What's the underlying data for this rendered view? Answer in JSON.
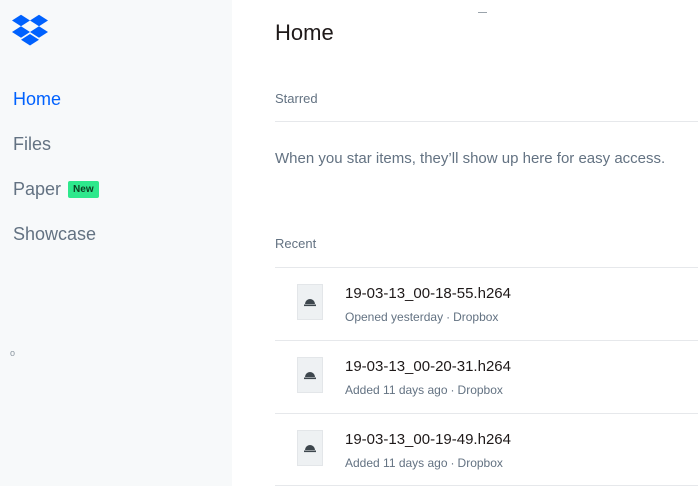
{
  "sidebar": {
    "logo_icon": "dropbox-logo-icon",
    "items": [
      {
        "label": "Home",
        "active": true
      },
      {
        "label": "Files",
        "active": false
      },
      {
        "label": "Paper",
        "active": false,
        "badge": "New"
      },
      {
        "label": "Showcase",
        "active": false
      }
    ],
    "stray_mark": "o"
  },
  "main": {
    "title": "Home",
    "starred": {
      "label": "Starred",
      "empty_text": "When you star items, they’ll show up here for easy access."
    },
    "recent": {
      "label": "Recent",
      "files": [
        {
          "name": "19-03-13_00-18-55.h264",
          "activity": "Opened yesterday",
          "location": "Dropbox",
          "icon": "video-file-icon"
        },
        {
          "name": "19-03-13_00-20-31.h264",
          "activity": "Added 11 days ago",
          "location": "Dropbox",
          "icon": "video-file-icon"
        },
        {
          "name": "19-03-13_00-19-49.h264",
          "activity": "Added 11 days ago",
          "location": "Dropbox",
          "icon": "video-file-icon"
        }
      ]
    }
  },
  "colors": {
    "accent": "#0061fe",
    "badge": "#2ee88c",
    "sidebar_bg": "#f7f9fa",
    "muted_text": "#637282"
  }
}
